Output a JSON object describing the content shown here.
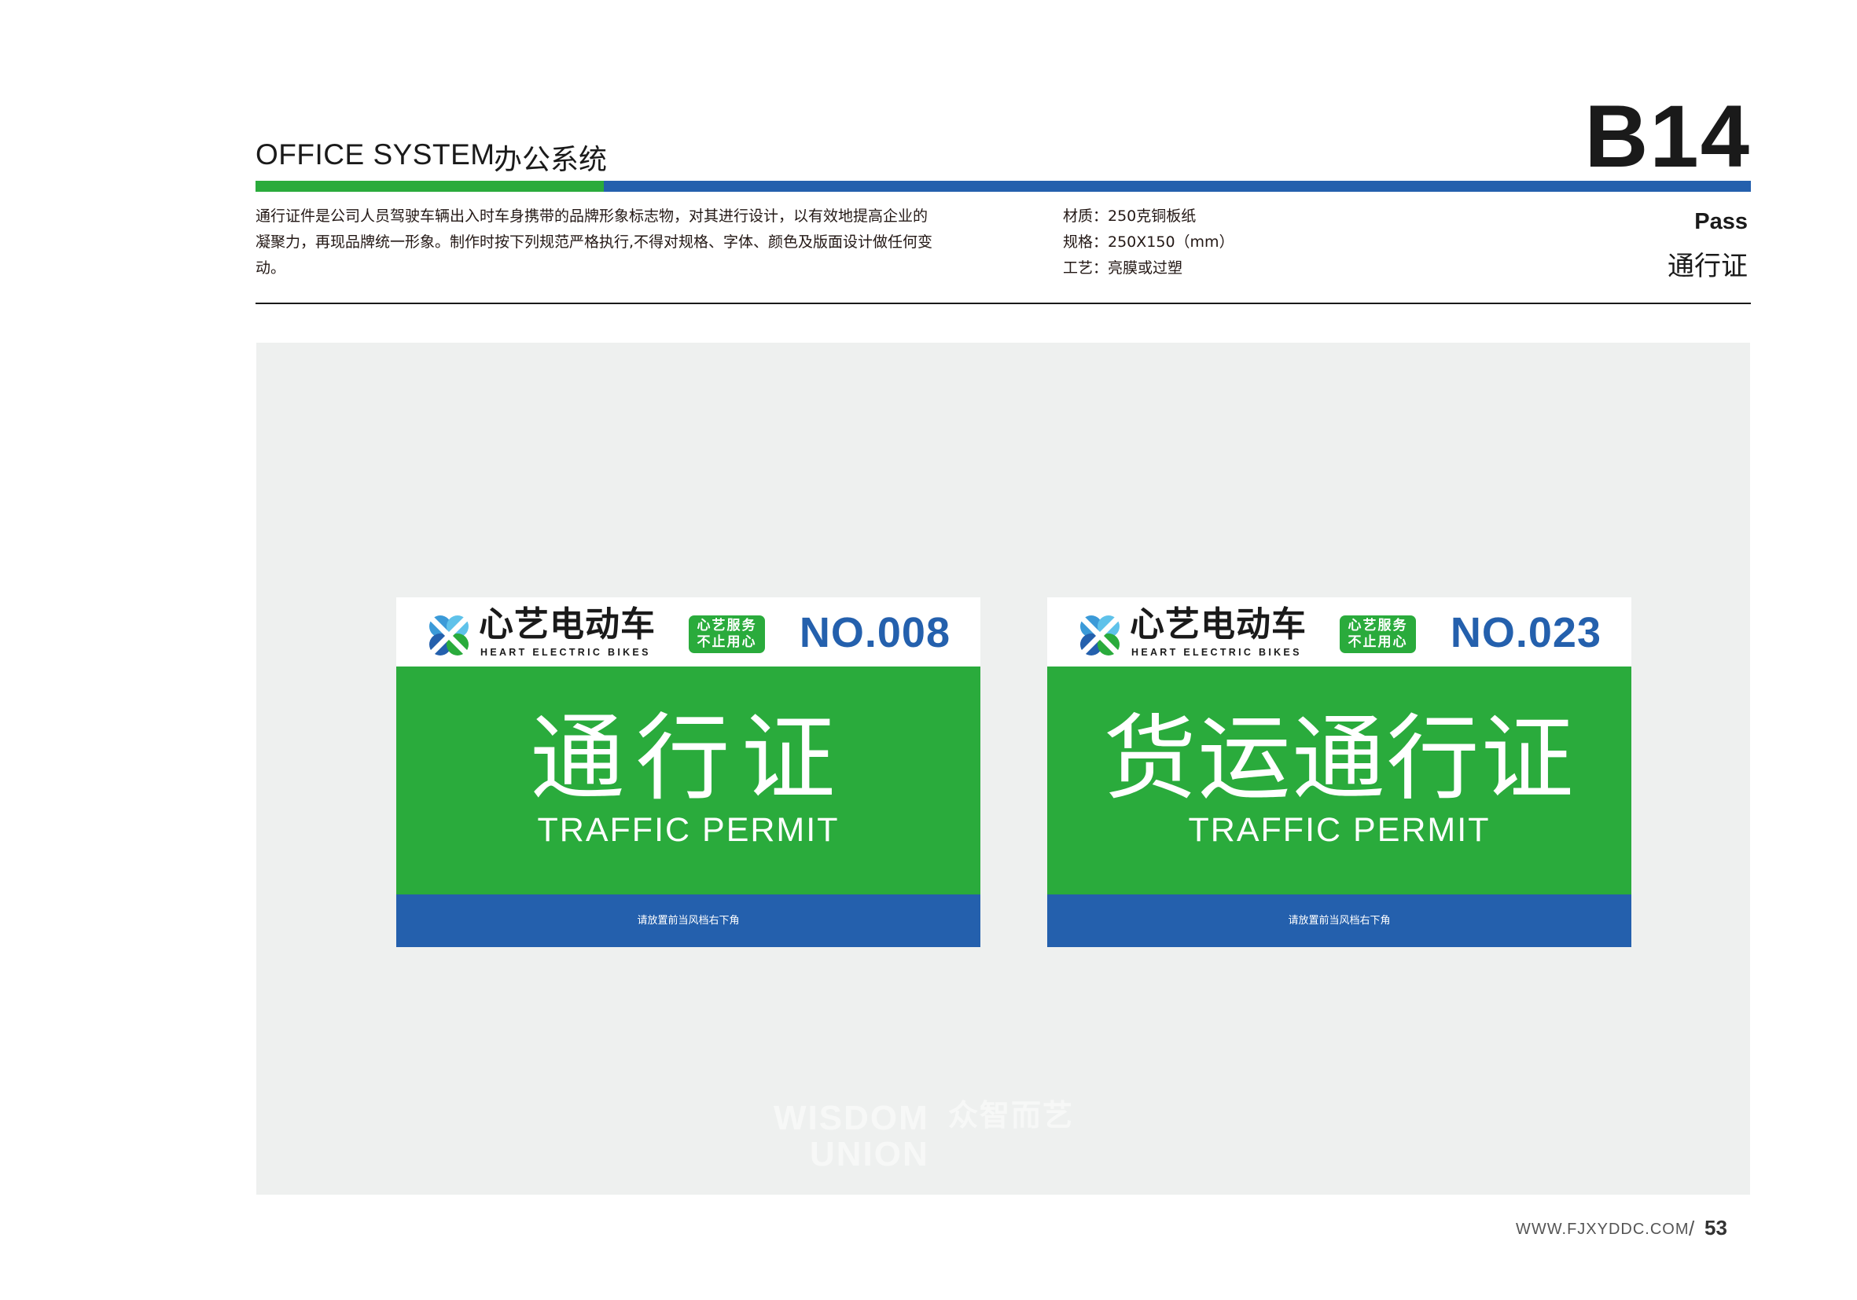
{
  "header": {
    "section_en": "OFFICE SYSTEM",
    "section_cn": "办公系统",
    "page_code": "B14",
    "item_en": "Pass",
    "item_cn": "通行证"
  },
  "description": [
    "通行证件是公司人员驾驶车辆出入时车身携带的品牌形象标志物，对其进行设计，以有效地提高企业的",
    "凝聚力，再现品牌统一形象。制作时按下列规范严格执行,不得对规格、字体、颜色及版面设计做任何变",
    "动。"
  ],
  "specs": {
    "material": "材质：250克铜板纸",
    "size": "规格：250X150（mm）",
    "process": "工艺：亮膜或过塑"
  },
  "brand": {
    "name_cn": "心艺电动车",
    "name_en": "HEART ELECTRIC BIKES",
    "slogan_line1": "心艺服务",
    "slogan_line2": "不止用心"
  },
  "cards": [
    {
      "serial": "NO.008",
      "title_cn": "通行证",
      "title_en": "TRAFFIC PERMIT",
      "note": "请放置前当风档右下角"
    },
    {
      "serial": "NO.023",
      "title_cn": "货运通行证",
      "title_en": "TRAFFIC PERMIT",
      "note": "请放置前当风档右下角"
    }
  ],
  "watermark": {
    "line1": "WISDOM",
    "line2": "UNION",
    "cn": "众智而艺"
  },
  "footer": {
    "url": "WWW.FJXYDDC.COM",
    "slash": "/",
    "page_number": "53"
  },
  "colors": {
    "brand_green": "#2aab3c",
    "brand_blue": "#2460ad",
    "stage_bg": "#eef0ef"
  }
}
